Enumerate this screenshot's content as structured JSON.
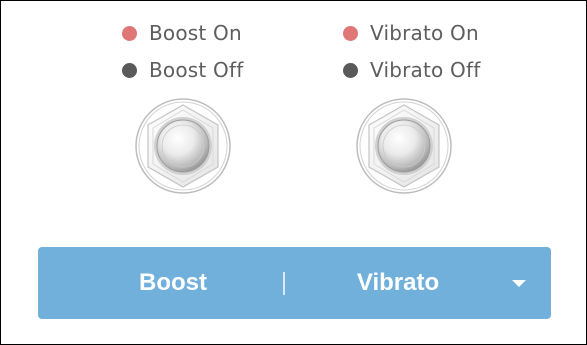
{
  "legend": {
    "boost": {
      "on_label": "Boost On",
      "off_label": "Boost Off"
    },
    "vibrato": {
      "on_label": "Vibrato On",
      "off_label": "Vibrato Off"
    }
  },
  "colors": {
    "on_dot": "#e07676",
    "off_dot": "#5a5a5a",
    "bar_background": "#72b0dc",
    "bar_text": "#ffffff"
  },
  "pedals": [
    {
      "name": "boost",
      "icon": "footswitch-icon"
    },
    {
      "name": "vibrato",
      "icon": "footswitch-icon"
    }
  ],
  "selector": {
    "left_label": "Boost",
    "right_label": "Vibrato",
    "dropdown_icon": "chevron-down-icon"
  }
}
